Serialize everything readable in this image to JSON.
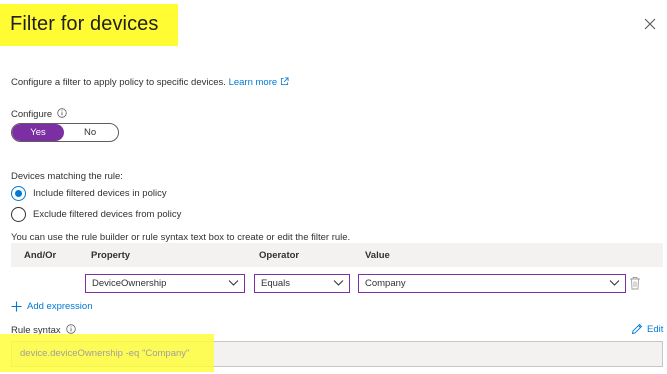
{
  "panel": {
    "title": "Filter for devices",
    "description": "Configure a filter to apply policy to specific devices.",
    "learn_more": "Learn more",
    "configure_label": "Configure",
    "toggle": {
      "yes": "Yes",
      "no": "No",
      "selected": "Yes"
    },
    "matching_label": "Devices matching the rule:",
    "radios": [
      {
        "label": "Include filtered devices in policy",
        "selected": true
      },
      {
        "label": "Exclude filtered devices from policy",
        "selected": false
      }
    ],
    "help_text": "You can use the rule builder or rule syntax text box to create or edit the filter rule.",
    "columns": [
      "And/Or",
      "Property",
      "Operator",
      "Value"
    ],
    "rule_row": {
      "property": "DeviceOwnership",
      "operator": "Equals",
      "value": "Company"
    },
    "add_expression": "Add expression",
    "rule_syntax_label": "Rule syntax",
    "edit": "Edit",
    "rule_syntax": "device.deviceOwnership -eq \"Company\""
  },
  "colors": {
    "accent": "#7c2fa3",
    "link": "#0078d4",
    "highlight": "#fffc33"
  },
  "icons": [
    "close-icon",
    "external-link-icon",
    "info-icon",
    "chevron-down-icon",
    "delete-icon",
    "plus-icon",
    "pencil-icon"
  ]
}
